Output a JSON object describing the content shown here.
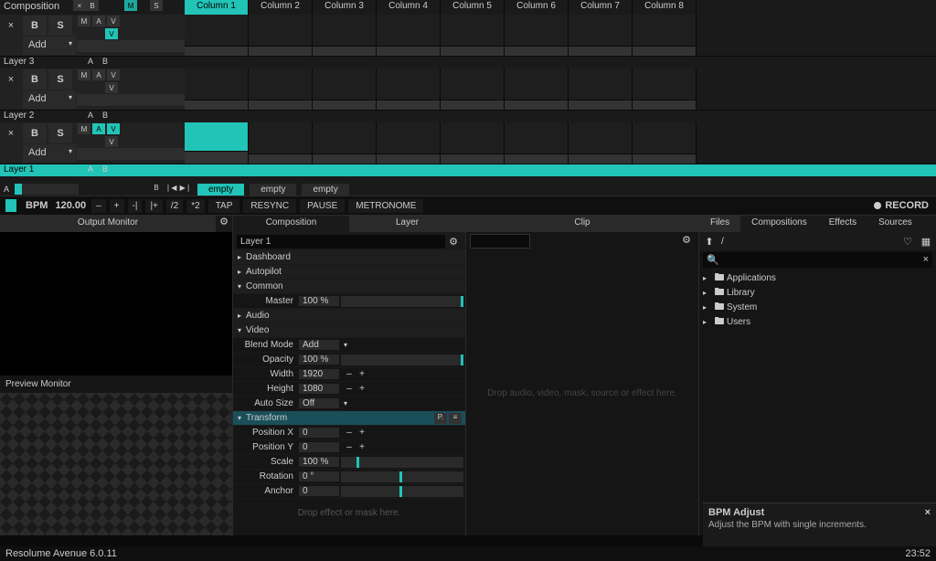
{
  "comp": {
    "label": "Composition",
    "x": "×",
    "b": "B",
    "badges": {
      "m": "M",
      "s": "S"
    }
  },
  "columns": [
    "Column 1",
    "Column 2",
    "Column 3",
    "Column 4",
    "Column 5",
    "Column 6",
    "Column 7",
    "Column 8"
  ],
  "active_column": 0,
  "layers": [
    {
      "name": "Layer 3",
      "footer_ab": [
        "A",
        "B"
      ],
      "mav": [
        "M",
        "A",
        "V"
      ]
    },
    {
      "name": "Layer 2",
      "footer_ab": [
        "A",
        "B"
      ],
      "mav": [
        "M",
        "A",
        "V"
      ]
    },
    {
      "name": "Layer 1",
      "footer_ab": [
        "A",
        "B"
      ],
      "mav": [
        "M",
        "A",
        "V"
      ],
      "highlight": true
    }
  ],
  "layer_btns": {
    "b": "B",
    "s": "S",
    "add": "Add",
    "x": "×"
  },
  "scroll": {
    "a": "A",
    "nav": [
      "B",
      "❘◀",
      "▶❘"
    ],
    "empties": [
      "empty",
      "empty",
      "empty"
    ],
    "active_empty": 0
  },
  "transport": {
    "bpm_label": "BPM",
    "bpm": "120.00",
    "dec": "–",
    "inc": "+",
    "div_dec": "-|",
    "div_inc": "|+",
    "half": "/2",
    "double": "*2",
    "tap": "TAP",
    "resync": "RESYNC",
    "pause": "PAUSE",
    "metronome": "METRONOME",
    "record": "RECORD"
  },
  "panels": {
    "output": {
      "title": "Output Monitor",
      "preview": "Preview Monitor"
    },
    "complay": {
      "tabs": [
        "Composition",
        "Layer"
      ],
      "active": 1,
      "layer_name": "Layer 1"
    },
    "clip": {
      "title": "Clip",
      "drop": "Drop audio, video, mask, source or effect here."
    },
    "files": {
      "tabs": [
        "Files",
        "Compositions",
        "Effects",
        "Sources"
      ],
      "active": 0,
      "path": "/"
    }
  },
  "props": {
    "dashboard": "Dashboard",
    "autopilot": "Autopilot",
    "common": "Common",
    "master": {
      "label": "Master",
      "value": "100 %"
    },
    "audio": "Audio",
    "video": "Video",
    "blend": {
      "label": "Blend Mode",
      "value": "Add"
    },
    "opacity": {
      "label": "Opacity",
      "value": "100 %"
    },
    "width": {
      "label": "Width",
      "value": "1920"
    },
    "height": {
      "label": "Height",
      "value": "1080"
    },
    "autosize": {
      "label": "Auto Size",
      "value": "Off"
    },
    "transform": {
      "label": "Transform",
      "p": "P."
    },
    "posx": {
      "label": "Position X",
      "value": "0"
    },
    "posy": {
      "label": "Position Y",
      "value": "0"
    },
    "scale": {
      "label": "Scale",
      "value": "100 %"
    },
    "rotation": {
      "label": "Rotation",
      "value": "0 °"
    },
    "anchor": {
      "label": "Anchor",
      "value": "0"
    },
    "drop": "Drop effect or mask here."
  },
  "folders": [
    "Applications",
    "Library",
    "System",
    "Users"
  ],
  "tooltip": {
    "title": "BPM Adjust",
    "body": "Adjust the BPM with single increments.",
    "x": "×"
  },
  "status": {
    "left": "Resolume Avenue 6.0.11",
    "right": "23:52"
  }
}
